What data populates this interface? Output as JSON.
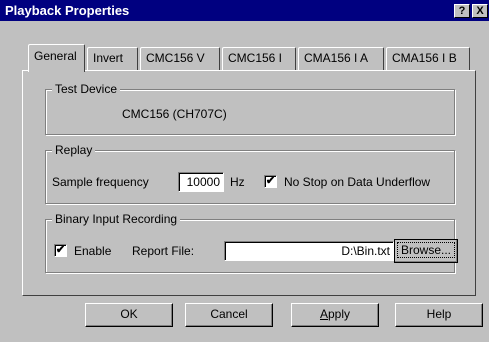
{
  "window": {
    "title": "Playback Properties",
    "help_glyph": "?",
    "close_glyph": "X"
  },
  "tabs": [
    {
      "label": "General",
      "active": true
    },
    {
      "label": "Invert",
      "active": false
    },
    {
      "label": "CMC156 V",
      "active": false
    },
    {
      "label": "CMC156 I",
      "active": false
    },
    {
      "label": "CMA156 I A",
      "active": false
    },
    {
      "label": "CMA156 I B",
      "active": false
    }
  ],
  "test_device": {
    "group_title": "Test Device",
    "value": "CMC156 (CH707C)"
  },
  "replay": {
    "group_title": "Replay",
    "sample_frequency_label": "Sample frequency",
    "sample_frequency_value": "10000",
    "unit": "Hz",
    "no_stop_label": "No Stop on Data Underflow",
    "no_stop_checked": true,
    "check_glyph": "✔"
  },
  "binary_input": {
    "group_title": "Binary Input Recording",
    "enable_label": "Enable",
    "enable_checked": true,
    "report_file_label": "Report File:",
    "report_file_value": "D:\\Bin.txt",
    "browse_label": "Browse..."
  },
  "buttons": {
    "ok": "OK",
    "cancel": "Cancel",
    "apply_first": "A",
    "apply_rest": "pply",
    "help": "Help"
  }
}
